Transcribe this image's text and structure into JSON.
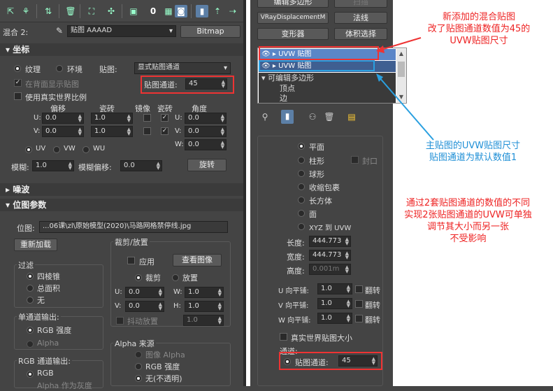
{
  "left": {
    "blend_label": "混合 2:",
    "map_name": "贴图 AAAAD",
    "bitmap_btn": "Bitmap",
    "coords": {
      "title": "坐标",
      "texture": "纹理",
      "environ": "环境",
      "map_label": "贴图:",
      "map_value": "显式贴图通道",
      "show_back": "在背面显示贴图",
      "real_world": "使用真实世界比例",
      "channel_label": "贴图通道:",
      "channel_value": "45",
      "offset": "偏移",
      "tiling": "瓷砖",
      "mirror": "镜像",
      "tile": "瓷砖",
      "angle": "角度",
      "u_label": "U:",
      "v_label": "V:",
      "w_label": "W:",
      "u_off": "0.0",
      "v_off": "0.0",
      "u_tile": "1.0",
      "v_tile": "1.0",
      "u_ang": "0.0",
      "v_ang": "0.0",
      "w_ang": "0.0",
      "uv": "UV",
      "vw": "VW",
      "wu": "WU",
      "blur": "模糊:",
      "blur_val": "1.0",
      "blur_off": "模糊偏移:",
      "blur_off_val": "0.0",
      "rotate": "旋转"
    },
    "noise": {
      "title": "噪波"
    },
    "bitmap": {
      "title": "位图参数",
      "path_label": "位图:",
      "path": "...06课\\zl\\原始模型(2020)\\马路网格禁停线.jpg",
      "reload": "重新加载",
      "crop_title": "裁剪/放置",
      "apply": "应用",
      "view": "查看图像",
      "crop": "裁剪",
      "place": "放置",
      "u": "U:",
      "v": "V:",
      "w": "W:",
      "h": "H:",
      "u_val": "0.0",
      "v_val": "0.0",
      "w_val": "1.0",
      "h_val": "1.0",
      "jitter": "抖动放置",
      "jitter_val": "1.0",
      "filter_title": "过滤",
      "f1": "四棱锥",
      "f2": "总面积",
      "f3": "无",
      "mono_title": "单通道输出:",
      "mono1": "RGB 强度",
      "mono2": "Alpha",
      "rgb_title": "RGB 通道输出:",
      "rgb1": "RGB",
      "rgb2": "Alpha 作为灰度",
      "alpha_title": "Alpha 来源",
      "a1": "图像 Alpha",
      "a2": "RGB 强度",
      "a3": "无(不透明)"
    }
  },
  "right": {
    "top_btns": [
      "编辑多边形",
      "扫描",
      "VRayDisplacementM",
      "法线",
      "变形器",
      "体积选择"
    ],
    "stack": [
      "UVW 贴图",
      "UVW 贴图",
      "可编辑多边形",
      "顶点",
      "边"
    ],
    "params": {
      "plane": "平面",
      "cyl": "柱形",
      "cap": "封口",
      "sphere": "球形",
      "shrink": "收缩包裹",
      "box": "长方体",
      "face": "面",
      "xyz": "XYZ 到 UVW",
      "length_l": "长度:",
      "length": "444.773",
      "width_l": "宽度:",
      "width": "444.773",
      "height_l": "高度:",
      "height": "0.001m",
      "u_tile_l": "U 向平铺:",
      "v_tile_l": "V 向平铺:",
      "w_tile_l": "W 向平铺:",
      "tile_val": "1.0",
      "flip": "翻转",
      "real_world": "真实世界贴图大小",
      "channel_group": "通道:",
      "channel_label": "贴图通道:",
      "channel_value": "45"
    },
    "annotations": {
      "red1": "新添加的混合贴图\n改了贴图通道数值为45的\nUVW贴图尺寸",
      "blue1": "主贴图的UVW贴图尺寸\n贴图通道为默认数值1",
      "red2": "通过2套贴图通道的数值的不同\n实现2张贴图通道的UVW可单独\n调节其大小而另一张\n不受影响"
    }
  }
}
